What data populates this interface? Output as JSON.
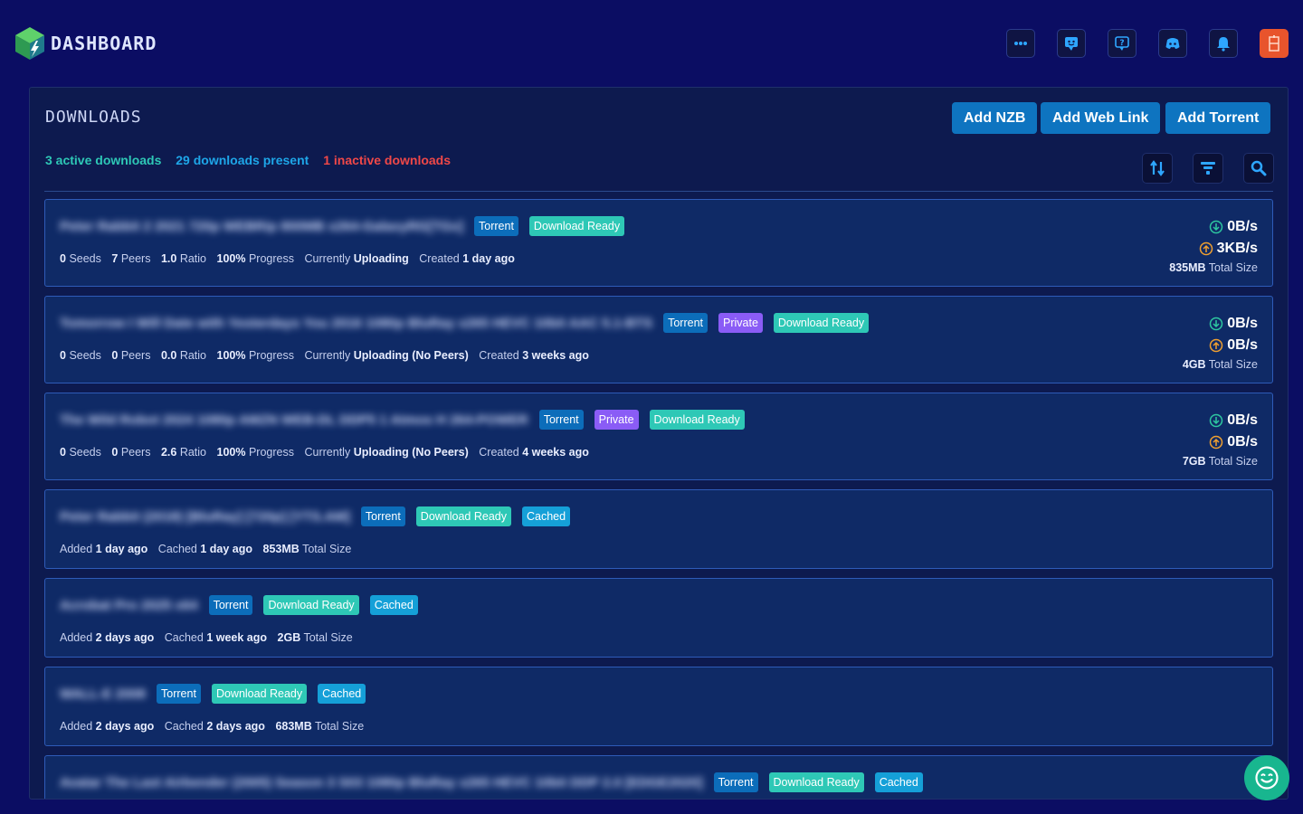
{
  "header": {
    "brand": "DASHBOARD",
    "icons": [
      "more-icon",
      "feedback-icon",
      "support-icon",
      "discord-icon",
      "bell-icon",
      "user-avatar"
    ]
  },
  "panel": {
    "title": "DOWNLOADS",
    "buttons": {
      "add_nzb": "Add NZB",
      "add_web_link": "Add Web Link",
      "add_torrent": "Add Torrent"
    },
    "stats": {
      "active": "3 active downloads",
      "present": "29 downloads present",
      "inactive": "1 inactive downloads"
    },
    "colors": {
      "active": "#2ec8b6",
      "present": "#1ea6e8",
      "inactive": "#f04848"
    }
  },
  "labels": {
    "seeds": "Seeds",
    "peers": "Peers",
    "ratio": "Ratio",
    "progress": "Progress",
    "currently": "Currently",
    "created": "Created",
    "total_size": "Total Size",
    "added": "Added",
    "cached": "Cached"
  },
  "downloads": [
    {
      "name": "Peter Rabbit 2 2021 720p WEBRip 800MB x264-GalaxyRG[TGx]",
      "tags": [
        "Torrent",
        "Download Ready"
      ],
      "seeds": "0",
      "peers": "7",
      "ratio": "1.0",
      "progress": "100%",
      "status": "Uploading",
      "created": "1 day ago",
      "down": "0B/s",
      "up": "3KB/s",
      "size": "835MB"
    },
    {
      "name": "Tomorrow I Will Date with Yesterdays You 2016 1080p BluRay x265 HEVC 10bit AAC 5.1-BTS",
      "tags": [
        "Torrent",
        "Private",
        "Download Ready"
      ],
      "seeds": "0",
      "peers": "0",
      "ratio": "0.0",
      "progress": "100%",
      "status": "Uploading (No Peers)",
      "created": "3 weeks ago",
      "down": "0B/s",
      "up": "0B/s",
      "size": "4GB"
    },
    {
      "name": "The Wild Robot 2024 1080p AMZN WEB-DL DDP5 1 Atmos H 264-POWER",
      "tags": [
        "Torrent",
        "Private",
        "Download Ready"
      ],
      "seeds": "0",
      "peers": "0",
      "ratio": "2.6",
      "progress": "100%",
      "status": "Uploading (No Peers)",
      "created": "4 weeks ago",
      "down": "0B/s",
      "up": "0B/s",
      "size": "7GB"
    },
    {
      "name": "Peter Rabbit (2018) [BluRay] [720p] [YTS.AM]",
      "tags": [
        "Torrent",
        "Download Ready",
        "Cached"
      ],
      "added": "1 day ago",
      "cached": "1 day ago",
      "size": "853MB"
    },
    {
      "name": "Acrobat Pro 2025 x64",
      "tags": [
        "Torrent",
        "Download Ready",
        "Cached"
      ],
      "added": "2 days ago",
      "cached": "1 week ago",
      "size": "2GB"
    },
    {
      "name": "WALL-E 2008",
      "tags": [
        "Torrent",
        "Download Ready",
        "Cached"
      ],
      "added": "2 days ago",
      "cached": "2 days ago",
      "size": "683MB"
    },
    {
      "name": "Avatar The Last Airbender (2005) Season 3 S03 1080p BluRay x265 HEVC 10bit DDP 2.0 [EDGE2020]",
      "tags": [
        "Torrent",
        "Download Ready",
        "Cached"
      ]
    }
  ]
}
